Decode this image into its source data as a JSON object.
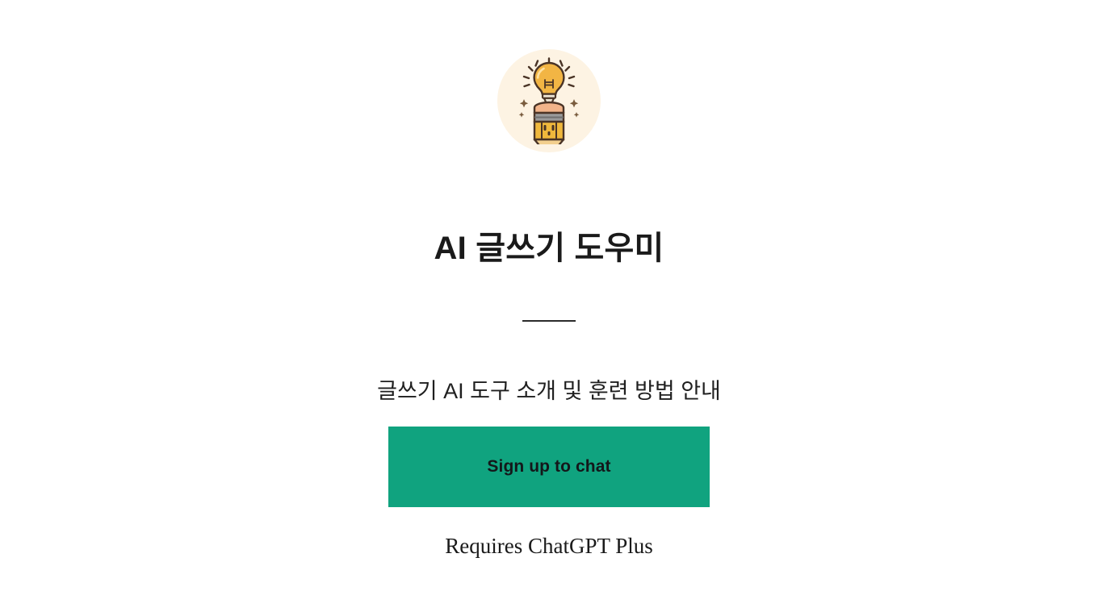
{
  "page": {
    "background_color": "#ffffff"
  },
  "logo": {
    "icon_name": "lightbulb-pencil-icon",
    "circle_color": "#fdf3e3",
    "bulb_color": "#f2b544",
    "bulb_highlight": "#ffd97a",
    "pencil_body_color": "#f0b83c",
    "pencil_eraser_color": "#f2b48a",
    "pencil_ferrule_color": "#8c8c8c",
    "pencil_tip_color": "#3b2b1f",
    "outline_color": "#4a3426"
  },
  "header": {
    "title": "AI 글쓰기 도우미"
  },
  "divider": {
    "color": "#2b2b2b"
  },
  "main": {
    "subtitle": "글쓰기 AI 도구 소개 및 훈련 방법 안내"
  },
  "cta": {
    "label": "Sign up to chat",
    "background_color": "#10a37f",
    "text_color": "#14171a"
  },
  "footer": {
    "note": "Requires ChatGPT Plus"
  }
}
